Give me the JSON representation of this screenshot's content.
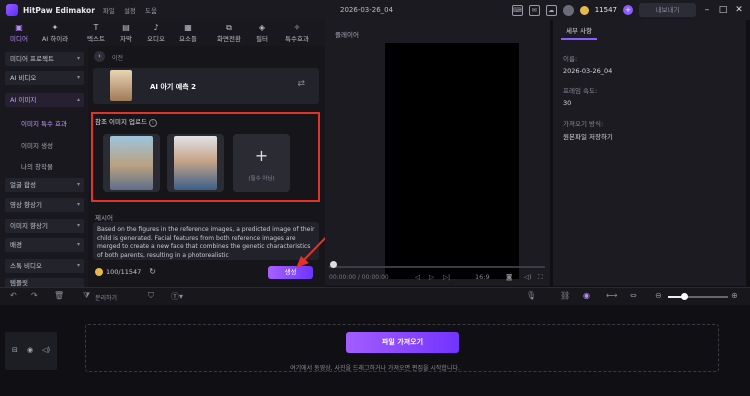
{
  "app": {
    "name": "HitPaw Edimakor",
    "menu": [
      "파일",
      "설정",
      "도움"
    ],
    "document_title": "2026-03-26_04",
    "credits": "11547",
    "export_label": "내보내기"
  },
  "toolbar": {
    "tabs": [
      {
        "icon": "media-icon",
        "label": "미디어"
      },
      {
        "icon": "ai-icon",
        "label": "AI 하이라"
      },
      {
        "icon": "text-icon",
        "label": "텍스트"
      },
      {
        "icon": "subtitle-icon",
        "label": "자막"
      },
      {
        "icon": "audio-icon",
        "label": "오디오"
      },
      {
        "icon": "elements-icon",
        "label": "요소들"
      },
      {
        "icon": "transition-icon",
        "label": "화면전환"
      },
      {
        "icon": "filter-icon",
        "label": "필터"
      },
      {
        "icon": "effects-icon",
        "label": "특수효과"
      }
    ]
  },
  "sidebar": {
    "items": [
      {
        "label": "미디어 프로젝트"
      },
      {
        "label": "AI 비디오"
      },
      {
        "label": "AI 이미지"
      }
    ],
    "sub_items": [
      "이미지 특수 효과",
      "이미지 생성",
      "나의 창작물"
    ],
    "items_after": [
      {
        "label": "얼굴 합성"
      },
      {
        "label": "영상 향상기"
      },
      {
        "label": "이미지 향상기"
      },
      {
        "label": "배경"
      },
      {
        "label": "스톡 비디오"
      },
      {
        "label": "템플릿"
      }
    ]
  },
  "panel": {
    "breadcrumb": "이전",
    "hero_title": "AI 아기 예측 2",
    "upload_label": "참조 이미지 업로드",
    "slot_note": "(필수 아님)",
    "prompt_label": "제시어",
    "prompt_text": "Based on the figures in the reference images, a predicted image of their child is generated. Facial features from both reference images are merged to create a new face that combines the genetic characteristics of both parents, resulting in a photorealistic",
    "credit_usage": "100/11547",
    "generate_label": "생성"
  },
  "player": {
    "title": "플레이어",
    "time": "00:00:00 / 00:00:00",
    "ratio": "16:9"
  },
  "properties": {
    "tab": "세부 사항",
    "name_label": "이름:",
    "name_value": "2026-03-26_04",
    "fps_label": "프레임 속도:",
    "fps_value": "30",
    "import_label": "가져오기 방식:",
    "import_value": "원본파일 저장하기"
  },
  "timeline": {
    "import_button": "파일 가져오기",
    "hint": "여기에서 동영상, 사진을 드래그하거나 가져오면 편집을 시작합니다.",
    "split_label": "분리하기"
  },
  "colors": {
    "accent": "#8b5cff",
    "highlight": "#e2322a"
  }
}
